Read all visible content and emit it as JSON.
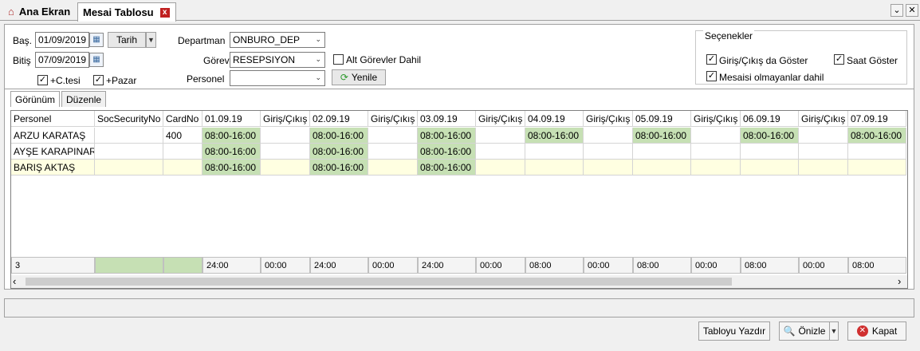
{
  "tabs": {
    "home": "Ana Ekran",
    "active": "Mesai Tablosu",
    "close": "x"
  },
  "window": {
    "dropdown": "⌄",
    "close": "✕"
  },
  "filters": {
    "start_label": "Baş.",
    "start_value": "01/09/2019",
    "end_label": "Bitiş",
    "end_value": "07/09/2019",
    "date_button": "Tarih",
    "saturday_label": "+C.tesi",
    "sunday_label": "+Pazar",
    "department_label": "Departman",
    "department_value": "ONBURO_DEP",
    "role_label": "Görev",
    "role_value": "RESEPSIYON",
    "sub_roles_label": "Alt Görevler Dahil",
    "person_label": "Personel",
    "person_value": "",
    "refresh_button": "Yenile"
  },
  "options": {
    "title": "Seçenekler",
    "show_inout": "Giriş/Çıkış da Göster",
    "show_time": "Saat Göster",
    "include_no_shift": "Mesaisi olmayanlar dahil"
  },
  "subtabs": {
    "view": "Görünüm",
    "edit": "Düzenle"
  },
  "grid": {
    "columns": [
      "Personel",
      "SocSecurityNo",
      "CardNo",
      "01.09.19",
      "Giriş/Çıkış",
      "02.09.19",
      "Giriş/Çıkış",
      "03.09.19",
      "Giriş/Çıkış",
      "04.09.19",
      "Giriş/Çıkış",
      "05.09.19",
      "Giriş/Çıkış",
      "06.09.19",
      "Giriş/Çıkış",
      "07.09.19"
    ],
    "rows": [
      [
        "ARZU KARATAŞ",
        "",
        "400",
        "08:00-16:00",
        "",
        "08:00-16:00",
        "",
        "08:00-16:00",
        "",
        "08:00-16:00",
        "",
        "08:00-16:00",
        "",
        "08:00-16:00",
        "",
        "08:00-16:00"
      ],
      [
        "AYŞE KARAPINAR",
        "",
        "",
        "08:00-16:00",
        "",
        "08:00-16:00",
        "",
        "08:00-16:00",
        "",
        "",
        "",
        "",
        "",
        "",
        "",
        ""
      ],
      [
        "BARIŞ AKTAŞ",
        "",
        "",
        "08:00-16:00",
        "",
        "08:00-16:00",
        "",
        "08:00-16:00",
        "",
        "",
        "",
        "",
        "",
        "",
        "",
        ""
      ]
    ],
    "footer": [
      "3",
      "",
      "",
      "24:00",
      "00:00",
      "24:00",
      "00:00",
      "24:00",
      "00:00",
      "08:00",
      "00:00",
      "08:00",
      "00:00",
      "08:00",
      "00:00",
      "08:00"
    ]
  },
  "scroll": {
    "left": "‹",
    "right": "›"
  },
  "actions": {
    "print": "Tabloyu Yazdır",
    "preview": "Önizle",
    "close": "Kapat"
  },
  "colors": {
    "shift": "#c6e0b4",
    "selected_row": "#ffffe1"
  }
}
